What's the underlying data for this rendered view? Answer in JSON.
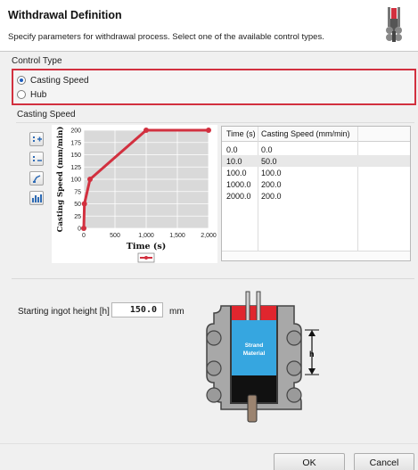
{
  "dialog": {
    "title": "Withdrawal Definition",
    "description": "Specify parameters for withdrawal process. Select one of the available control types."
  },
  "control_type": {
    "label": "Control Type",
    "options": [
      {
        "label": "Casting Speed",
        "selected": true
      },
      {
        "label": "Hub",
        "selected": false
      }
    ],
    "highlight_color": "#d2303f"
  },
  "casting_speed": {
    "section_label": "Casting Speed",
    "toolbar_icons": [
      "add-point-icon",
      "remove-point-icon",
      "fit-view-icon",
      "table-import-icon"
    ]
  },
  "chart_data": {
    "type": "line",
    "xlabel": "Time (s)",
    "ylabel": "Casting Speed (mm/min)",
    "x_ticks": [
      "0",
      "500",
      "1,000",
      "1,500",
      "2,000"
    ],
    "y_ticks": [
      "0",
      "25",
      "50",
      "75",
      "100",
      "125",
      "150",
      "175",
      "200"
    ],
    "xlim": [
      0,
      2000
    ],
    "ylim": [
      0,
      200
    ],
    "series": [
      {
        "x": [
          0,
          10,
          100,
          1000,
          2000
        ],
        "y": [
          0,
          50,
          100,
          200,
          200
        ],
        "color": "#d2303f"
      }
    ],
    "grid": true,
    "legend": "bottom"
  },
  "table": {
    "headers": [
      "Time (s)",
      "Casting Speed (mm/min)"
    ],
    "rows": [
      [
        "0.0",
        "0.0"
      ],
      [
        "10.0",
        "50.0"
      ],
      [
        "100.0",
        "100.0"
      ],
      [
        "1000.0",
        "200.0"
      ],
      [
        "2000.0",
        "200.0"
      ]
    ],
    "selected_row": 1
  },
  "ingot": {
    "label": "Starting ingot height [h]",
    "value": "150.0",
    "unit": "mm"
  },
  "diagram": {
    "strand_text_line1": "Strand",
    "strand_text_line2": "Material",
    "h_label": "h"
  },
  "buttons": {
    "ok": "OK",
    "cancel": "Cancel"
  }
}
